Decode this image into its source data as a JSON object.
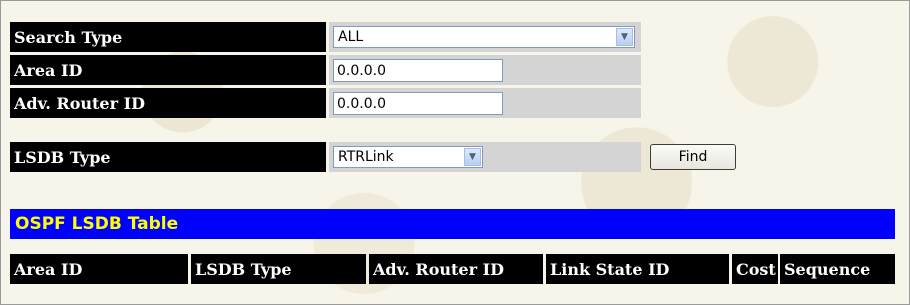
{
  "form": {
    "search_type": {
      "label": "Search Type",
      "value": "ALL"
    },
    "area_id": {
      "label": "Area ID",
      "value": "0.0.0.0"
    },
    "adv_router_id": {
      "label": "Adv. Router ID",
      "value": "0.0.0.0"
    },
    "lsdb_type": {
      "label": "LSDB Type",
      "value": "RTRLink"
    },
    "find_label": "Find"
  },
  "table": {
    "title": "OSPF LSDB Table",
    "columns": [
      "Area ID",
      "LSDB Type",
      "Adv. Router ID",
      "Link State ID",
      "Cost",
      "Sequence"
    ]
  },
  "colors": {
    "label_bg": "#000000",
    "table_title_bg": "#0000ff",
    "table_title_text": "#ffff00",
    "value_cell_bg": "#d4d4d4"
  }
}
